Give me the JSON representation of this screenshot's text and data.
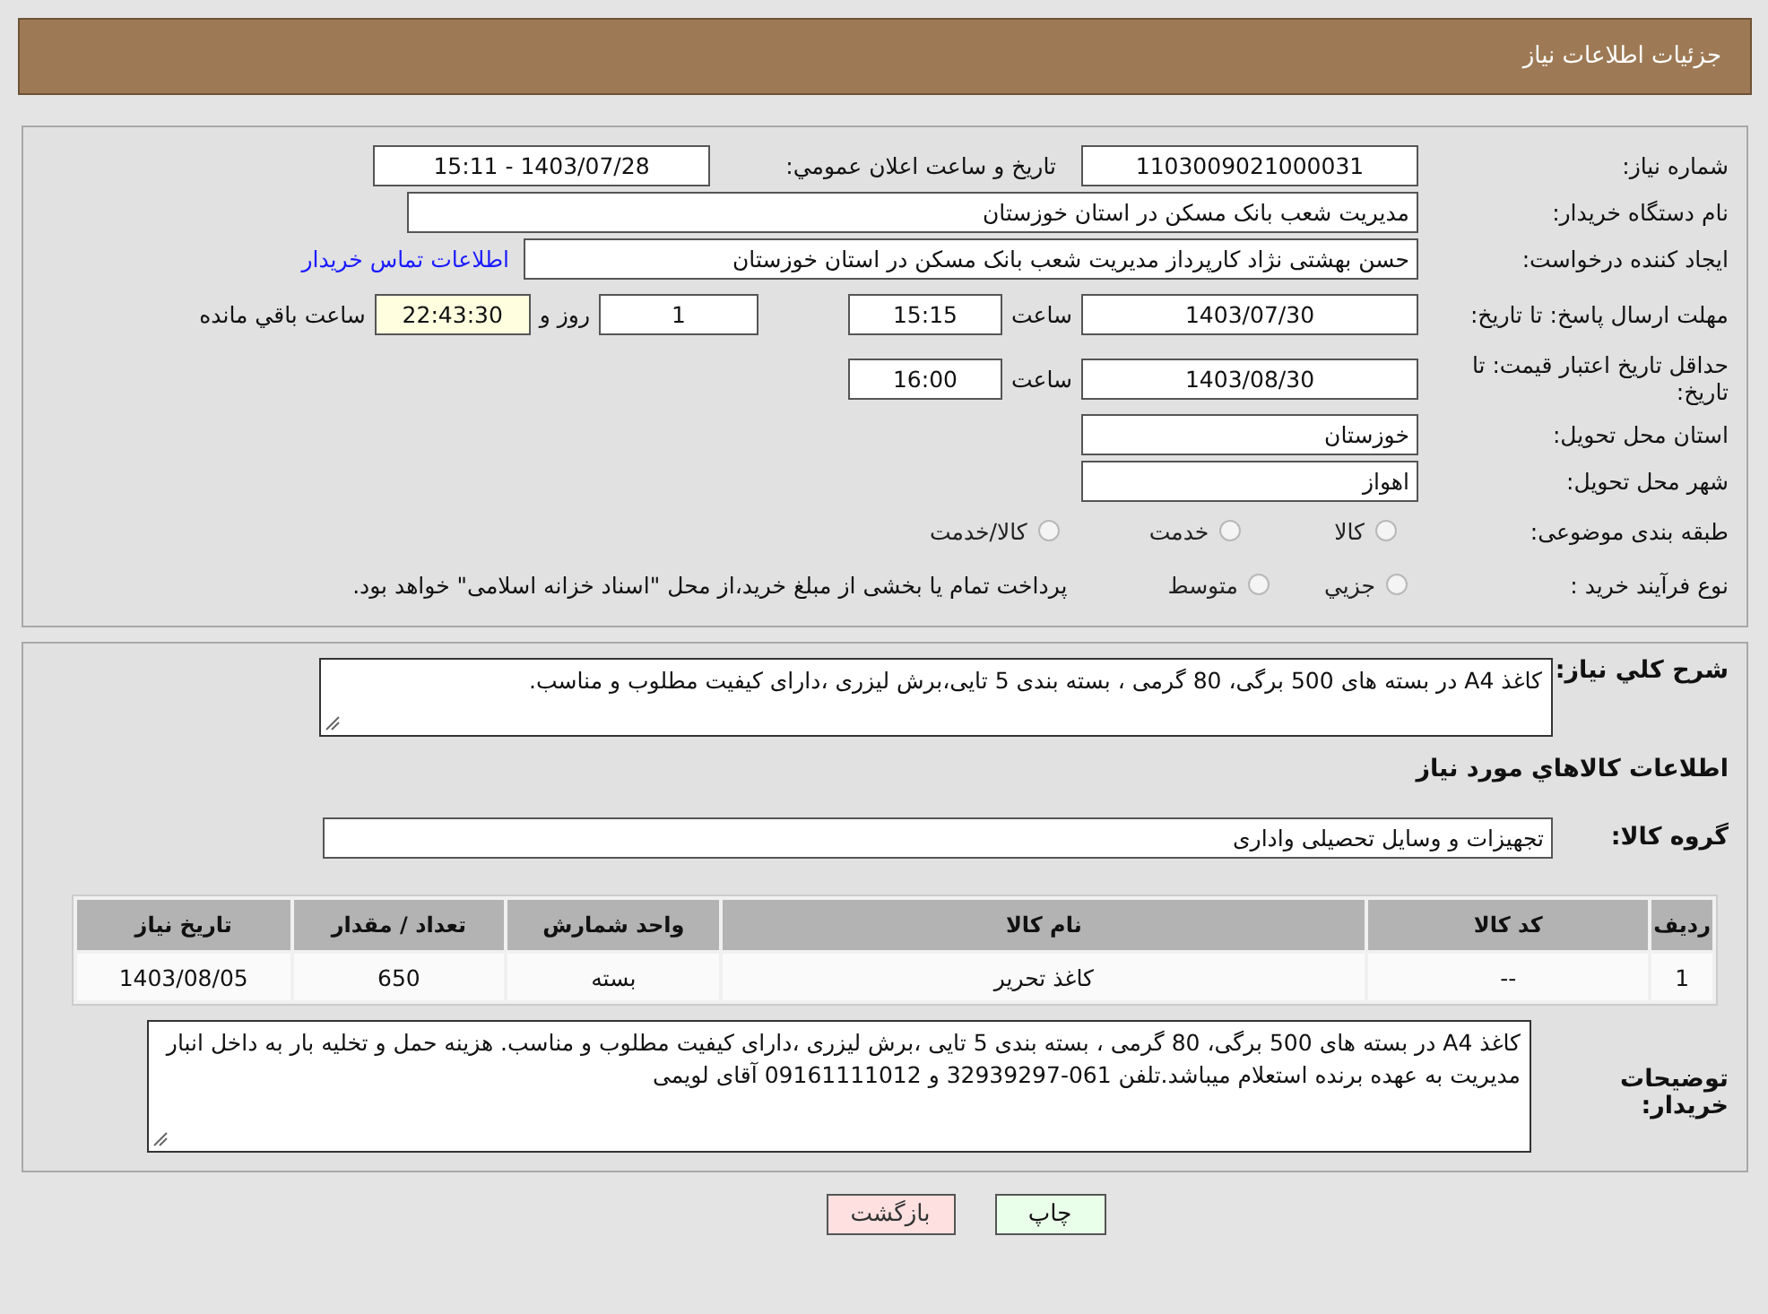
{
  "header": {
    "title": "جزئیات اطلاعات نیاز"
  },
  "summary": {
    "need_number": {
      "label": "شماره نیاز:",
      "value": "1103009021000031"
    },
    "announce": {
      "label": "تاريخ و ساعت اعلان عمومي:",
      "value": "1403/07/28 - 15:11"
    },
    "buyer_org": {
      "label": "نام دستگاه خريدار:",
      "value": "مدیریت شعب بانک مسکن در استان خوزستان"
    },
    "creator": {
      "label": "ایجاد کننده درخواست:",
      "value": "حسن بهشتی نژاد کارپرداز مدیریت شعب بانک مسکن در استان خوزستان",
      "link": "اطلاعات تماس خریدار"
    },
    "reply_deadline": {
      "label": "مهلت ارسال پاسخ: تا تاریخ:",
      "date": "1403/07/30",
      "time_label": "ساعت",
      "time": "15:15",
      "days": "1",
      "days_label": "روز و",
      "remaining": "22:43:30",
      "remaining_label": "ساعت باقي مانده"
    },
    "price_validity": {
      "label": "حداقل تاریخ اعتبار قیمت: تا تاریخ:",
      "date": "1403/08/30",
      "time_label": "ساعت",
      "time": "16:00"
    },
    "province": {
      "label": "استان محل تحویل:",
      "value": "خوزستان"
    },
    "city": {
      "label": "شهر محل تحویل:",
      "value": "اهواز"
    },
    "category": {
      "label": "طبقه بندی موضوعی:",
      "options": [
        {
          "label": "کالا",
          "selected": false
        },
        {
          "label": "خدمت",
          "selected": false
        },
        {
          "label": "کالا/خدمت",
          "selected": false
        }
      ]
    },
    "process": {
      "label": "نوع فرآیند خرید :",
      "options": [
        {
          "label": "جزيي",
          "selected": false
        },
        {
          "label": "متوسط",
          "selected": false
        }
      ],
      "note": "پرداخت تمام یا بخشی از مبلغ خرید،از محل \"اسناد خزانه اسلامی\" خواهد بود."
    }
  },
  "details": {
    "description": {
      "label": "شرح کلي نیاز:",
      "value": "کاغذ A4 در بسته های 500 برگی، 80 گرمی ، بسته بندی 5 تایی،برش لیزری ،دارای کیفیت مطلوب و مناسب."
    },
    "goods_heading": "اطلاعات کالاهاي مورد نیاز",
    "goods_group": {
      "label": "گروه کالا:",
      "value": "تجهیزات و وسایل تحصیلی واداری"
    },
    "table": {
      "columns": [
        "ردیف",
        "کد کالا",
        "نام کالا",
        "واحد شمارش",
        "تعداد / مقدار",
        "تاریخ نیاز"
      ],
      "rows": [
        [
          "1",
          "--",
          "کاغذ تحریر",
          "بسته",
          "650",
          "1403/08/05"
        ]
      ]
    },
    "buyer_notes": {
      "label": "توضیحات خریدار:",
      "value": "کاغذ A4 در بسته های 500 برگی، 80 گرمی ، بسته بندی 5 تایی ،برش لیزری ،دارای کیفیت مطلوب و مناسب. هزینه حمل و تخلیه بار به داخل انبار مدیریت به عهده برنده استعلام میباشد.تلفن 061-32939297 و 09161111012 آقای لویمی"
    }
  },
  "buttons": [
    {
      "kind": "print",
      "label": "چاپ"
    },
    {
      "kind": "back",
      "label": "بازگشت"
    }
  ]
}
